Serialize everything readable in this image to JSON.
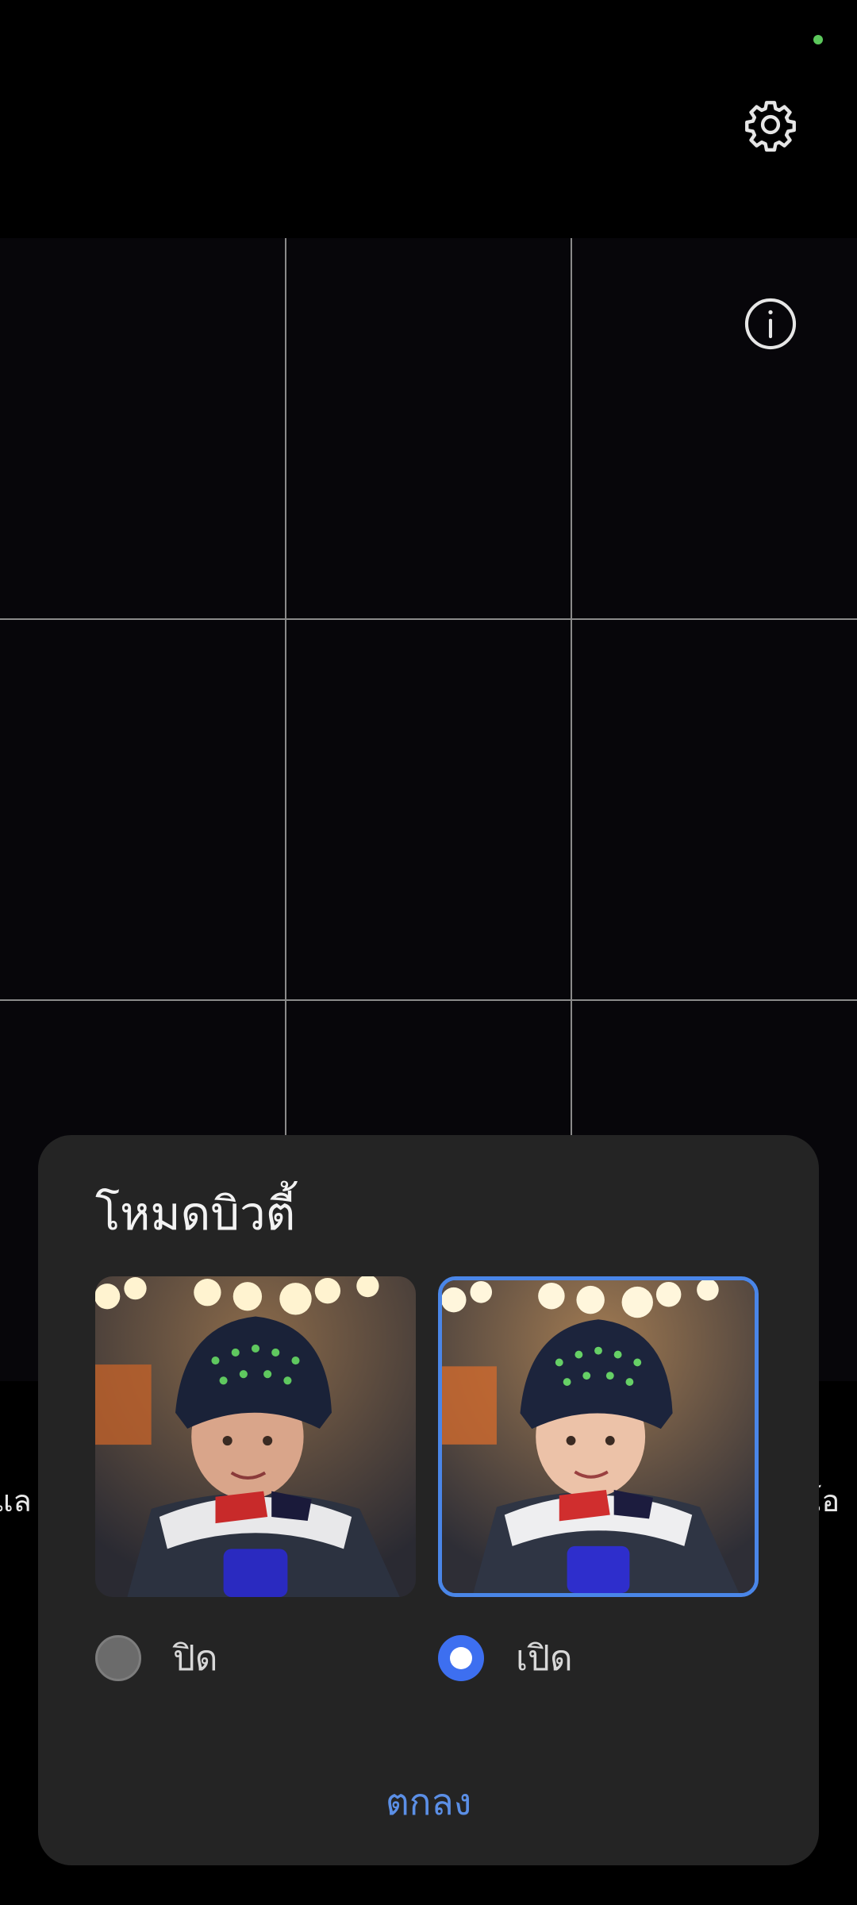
{
  "status_bar": {
    "indicator_color": "#5cc85c"
  },
  "top_bar": {
    "settings_icon": "gear-icon"
  },
  "viewfinder": {
    "info_icon": "info-icon",
    "grid": "3x3"
  },
  "mode_strip": {
    "left_partial": "ูแล",
    "right_partial": "โอ"
  },
  "dialog": {
    "title": "โหมดบิวตี้",
    "options": [
      {
        "label": "ปิด",
        "selected": false
      },
      {
        "label": "เปิด",
        "selected": true
      }
    ],
    "ok_label": "ตกลง"
  },
  "colors": {
    "accent": "#3d6ff0",
    "ok_text": "#5b8fe6",
    "dialog_bg": "#242424"
  }
}
